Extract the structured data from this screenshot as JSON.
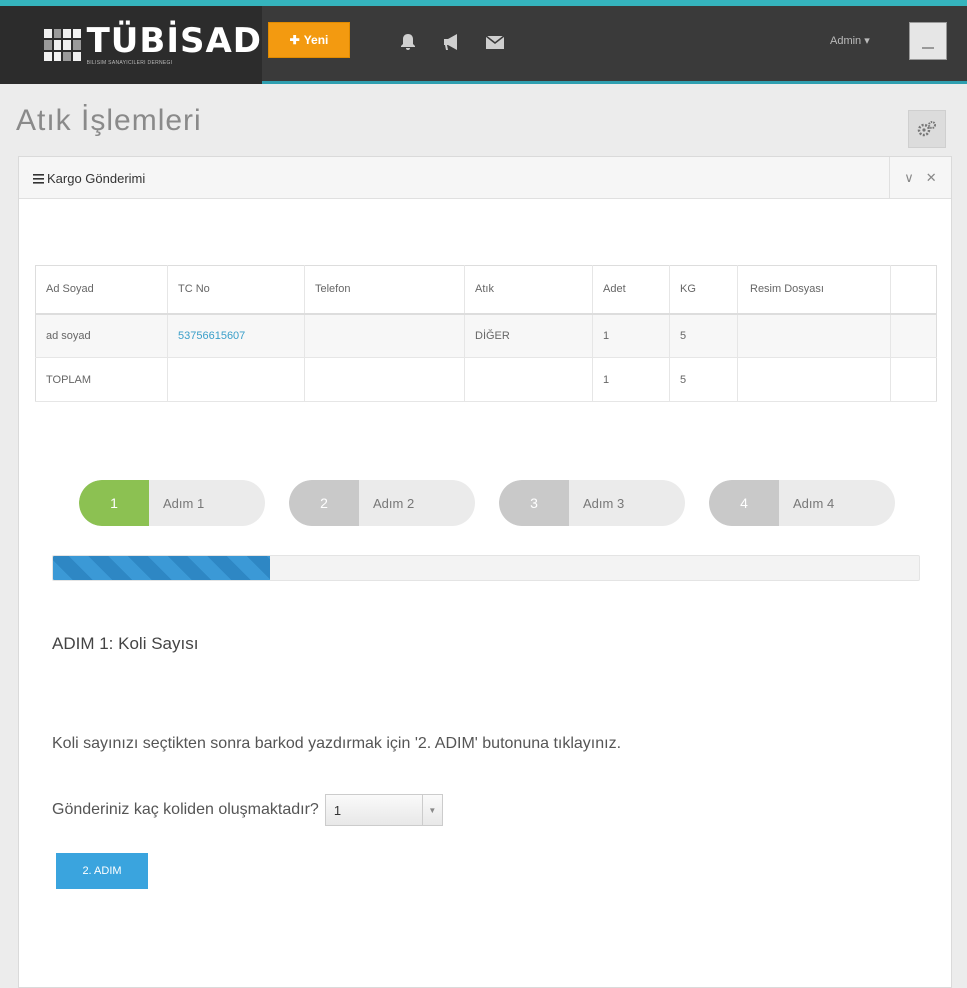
{
  "app": {
    "brand_name": "TÜBİSAD",
    "brand_sub": "BILISIM SANAYICILERI DERNEGI",
    "new_button_label": "Yeni",
    "user_name": "Admin"
  },
  "page": {
    "title": "Atık İşlemleri"
  },
  "panel": {
    "title": "Kargo Gönderimi"
  },
  "table": {
    "headers": [
      "Ad Soyad",
      "TC No",
      "Telefon",
      "Atık",
      "Adet",
      "KG",
      "Resim Dosyası",
      ""
    ],
    "rows": [
      [
        "ad soyad",
        "53756615607",
        "",
        "DİĞER",
        "1",
        "5",
        "",
        ""
      ],
      [
        "TOPLAM",
        "",
        "",
        "",
        "1",
        "5",
        "",
        ""
      ]
    ]
  },
  "wizard": {
    "steps": [
      {
        "num": "1",
        "label": "Adım 1",
        "active": true
      },
      {
        "num": "2",
        "label": "Adım 2",
        "active": false
      },
      {
        "num": "3",
        "label": "Adım 3",
        "active": false
      },
      {
        "num": "4",
        "label": "Adım 4",
        "active": false
      }
    ],
    "progress_percent": 25,
    "heading": "ADIM 1: Koli Sayısı",
    "instruction": "Koli sayınızı seçtikten sonra barkod yazdırmak için '2. ADIM' butonuna tıklayınız.",
    "question": "Gönderiniz kaç koliden oluşmaktadır?",
    "package_count_selected": "1",
    "next_button_label": "2. ADIM"
  },
  "colors": {
    "accent": "#35b4bd",
    "new_button": "#f39a10",
    "active_step": "#8cc152",
    "progress": "#3b99d6",
    "primary_button": "#3aa4de"
  },
  "icons": {
    "new": "plus-icon",
    "notifications": "bell-icon",
    "announcements": "megaphone-icon",
    "messages": "envelope-icon",
    "settings": "gears-icon",
    "panel_menu": "bars-icon",
    "collapse": "chevron-down-icon",
    "close": "close-icon"
  }
}
